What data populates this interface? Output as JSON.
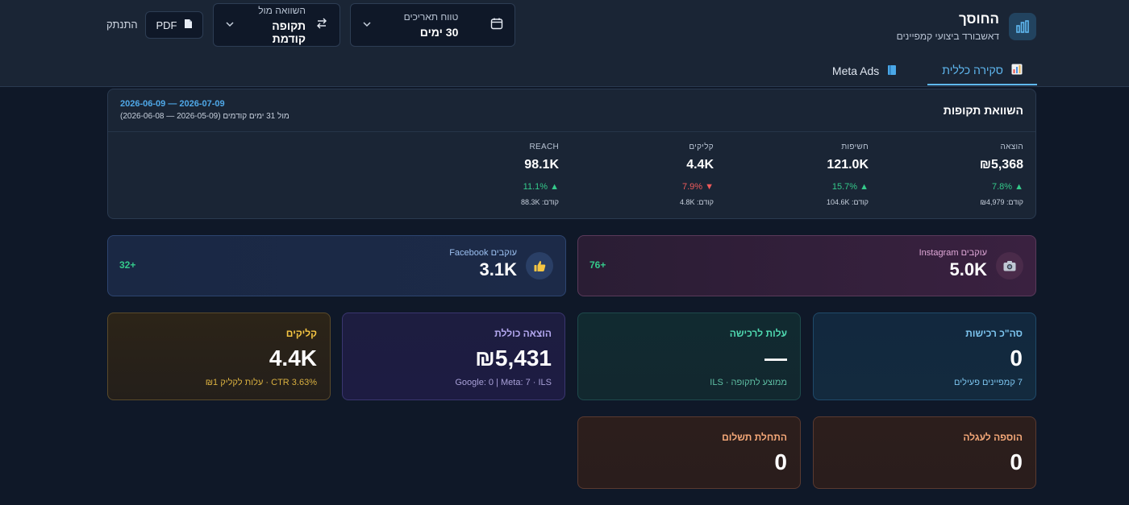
{
  "header": {
    "title": "החוסך",
    "subtitle": "דאשבורד ביצועי קמפיינים",
    "date_range": {
      "label": "טווח תאריכים",
      "value": "30 ימים"
    },
    "compare": {
      "label": "השוואה מול",
      "value": "תקופה קודמת"
    },
    "pdf_label": "PDF",
    "logout_label": "התנתק"
  },
  "tabs": [
    {
      "label": "סקירה כללית",
      "icon": "bar-chart-icon",
      "active": true
    },
    {
      "label": "Meta Ads",
      "icon": "book-icon",
      "active": false
    }
  ],
  "comparison": {
    "title": "השוואת תקופות",
    "current_range": "2026-06-09 — 2026-07-09",
    "previous_range": "מול 31 ימים קודמים (2026-05-09 — 2026-06-08)",
    "metrics": [
      {
        "label": "הוצאה",
        "value": "₪5,368",
        "change": "▲ 7.8%",
        "direction": "up",
        "previous": "קודם: ₪4,979"
      },
      {
        "label": "חשיפות",
        "value": "121.0K",
        "change": "▲ 15.7%",
        "direction": "up",
        "previous": "קודם: 104.6K"
      },
      {
        "label": "קליקים",
        "value": "4.4K",
        "change": "▼ 7.9%",
        "direction": "down",
        "previous": "קודם: 4.8K"
      },
      {
        "label": "REACH",
        "value": "98.1K",
        "change": "▲ 11.1%",
        "direction": "up",
        "previous": "קודם: 88.3K"
      }
    ]
  },
  "social": {
    "instagram": {
      "label": "עוקבים Instagram",
      "value": "5.0K",
      "delta": "+76",
      "icon": "camera-icon"
    },
    "facebook": {
      "label": "עוקבים Facebook",
      "value": "3.1K",
      "delta": "+32",
      "icon": "thumbs-up-icon"
    }
  },
  "kpis": {
    "purchases": {
      "label": "סה\"כ רכישות",
      "value": "0",
      "sub": "7 קמפיינים פעילים"
    },
    "cpa": {
      "label": "עלות לרכישה",
      "value": "—",
      "sub": "ממוצע לתקופה · ILS"
    },
    "spend": {
      "label": "הוצאה כוללת",
      "value": "₪5,431",
      "sub": "Google: 0 | Meta: 7 · ILS"
    },
    "clicks": {
      "label": "קליקים",
      "value": "4.4K",
      "sub": "CTR 3.63% · עלות לקליק ₪1"
    },
    "add_to_cart": {
      "label": "הוספה לעגלה",
      "value": "0"
    },
    "checkout": {
      "label": "התחלת תשלום",
      "value": "0"
    }
  },
  "colors": {
    "accent": "#5fb8f0",
    "positive": "#34c98a",
    "negative": "#f05b5b"
  }
}
